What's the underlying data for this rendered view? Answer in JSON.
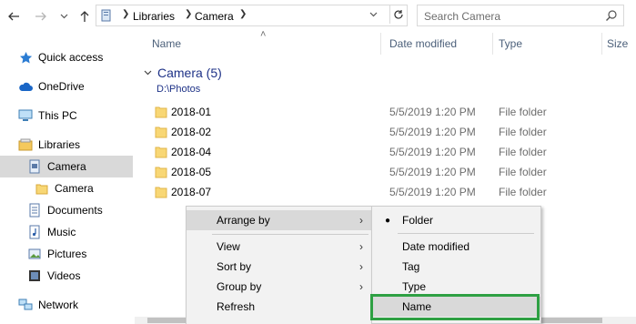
{
  "address": {
    "crumbs": [
      "Libraries",
      "Camera"
    ]
  },
  "search": {
    "placeholder": "Search Camera"
  },
  "nav": {
    "items": [
      {
        "label": "Quick access",
        "icon": "star-icon"
      },
      {
        "label": "OneDrive",
        "icon": "cloud-icon"
      },
      {
        "label": "This PC",
        "icon": "computer-icon"
      },
      {
        "label": "Libraries",
        "icon": "libraries-icon"
      },
      {
        "label": "Camera",
        "icon": "camera-library-icon"
      },
      {
        "label": "Camera",
        "icon": "folder-icon"
      },
      {
        "label": "Documents",
        "icon": "documents-icon"
      },
      {
        "label": "Music",
        "icon": "music-icon"
      },
      {
        "label": "Pictures",
        "icon": "pictures-icon"
      },
      {
        "label": "Videos",
        "icon": "videos-icon"
      },
      {
        "label": "Network",
        "icon": "network-icon"
      }
    ]
  },
  "columns": {
    "name": "Name",
    "date": "Date modified",
    "type": "Type",
    "size": "Size"
  },
  "group": {
    "title": "Camera (5)",
    "path": "D:\\Photos"
  },
  "files": [
    {
      "name": "2018-01",
      "date": "5/5/2019 1:20 PM",
      "type": "File folder"
    },
    {
      "name": "2018-02",
      "date": "5/5/2019 1:20 PM",
      "type": "File folder"
    },
    {
      "name": "2018-04",
      "date": "5/5/2019 1:20 PM",
      "type": "File folder"
    },
    {
      "name": "2018-05",
      "date": "5/5/2019 1:20 PM",
      "type": "File folder"
    },
    {
      "name": "2018-07",
      "date": "5/5/2019 1:20 PM",
      "type": "File folder"
    }
  ],
  "context_menu": {
    "items": [
      "Arrange by",
      "View",
      "Sort by",
      "Group by",
      "Refresh"
    ]
  },
  "submenu": {
    "items": [
      "Folder",
      "Date modified",
      "Tag",
      "Type",
      "Name"
    ],
    "checked": "Folder"
  },
  "colors": {
    "header_text": "#4c607a",
    "group_text": "#1e3287",
    "highlight_box": "#2ea043",
    "selection": "#d9d9d9"
  }
}
